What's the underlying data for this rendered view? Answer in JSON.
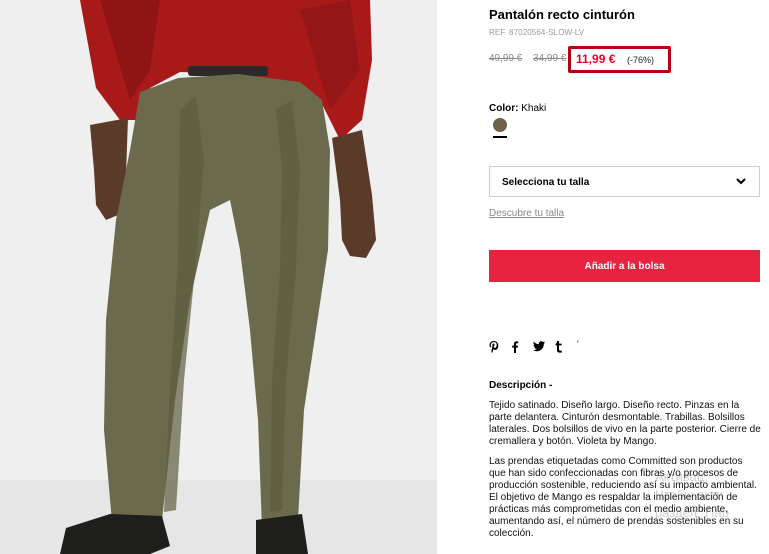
{
  "product": {
    "title": "Pantalón recto cinturón",
    "ref": "REF. 87020564-SLOW-LV",
    "old_price_1": "49,99 €",
    "old_price_2": "34,99 €",
    "price": "11,99 €",
    "discount": "(-76%)"
  },
  "colors": {
    "label": "Color:",
    "selected": "Khaki",
    "swatch_hex": "#6d6149",
    "accent": "#e8233f",
    "price_highlight": "#b40014"
  },
  "size": {
    "select_label": "Selecciona tu talla",
    "guide_link": "Descubre tu talla"
  },
  "actions": {
    "add_to_bag": "Añadir a la bolsa"
  },
  "share": {
    "icons": [
      "pinterest-icon",
      "facebook-icon",
      "twitter-icon",
      "tumblr-icon",
      "more-icon"
    ],
    "more_glyph": "'"
  },
  "description": {
    "title": "Descripción -",
    "paragraph_1": "Tejido satinado. Diseño largo. Diseño recto. Pinzas en la parte delantera. Cinturón desmontable. Trabillas. Bolsillos laterales. Dos bolsillos de vivo en la parte posterior. Cierre de cremallera y botón. Violeta by Mango.",
    "paragraph_2": "Las prendas etiquetadas como Committed son productos que han sido confeccionadas con fibras y/o procesos de producción sostenible, reduciendo así su impacto ambiental. El objetivo de Mango es respaldar la implementación de prácticas más comprometidas con el medio ambiente, aumentando así, el número de prendas sostenibles en su colección."
  },
  "watermark": {
    "line_1": "Активац",
    "line_2": "Чтобы акти",
    "line_3": "раздел \"Пар"
  }
}
